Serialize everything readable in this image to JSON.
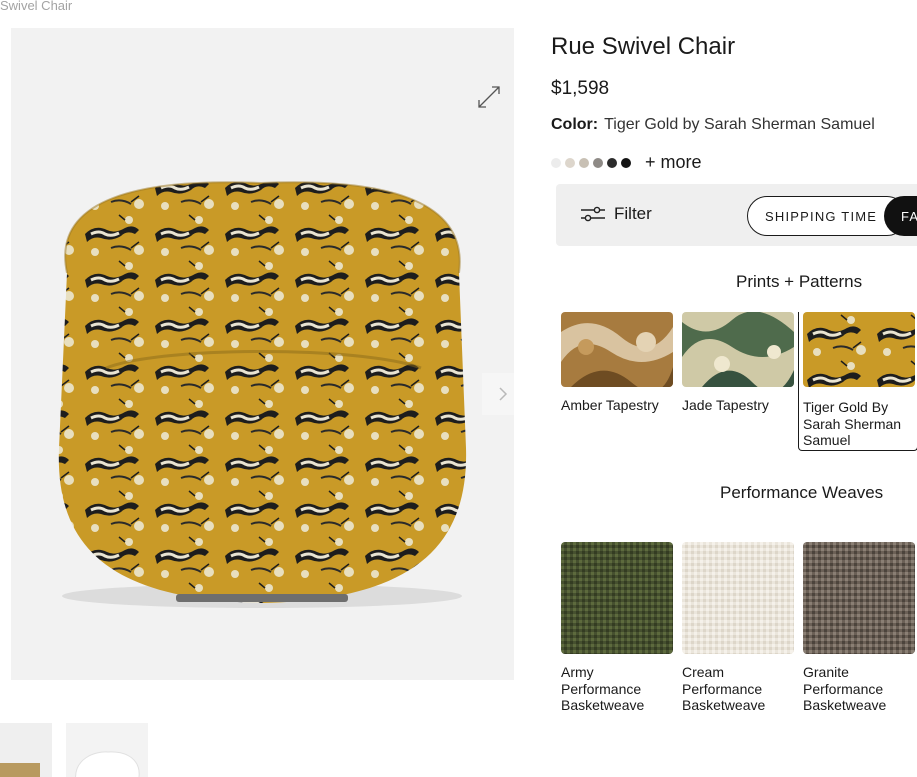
{
  "breadcrumb": {
    "current": "Swivel Chair"
  },
  "product": {
    "title": "Rue Swivel Chair",
    "price": "$1,598",
    "color_label": "Color:",
    "color_value": "Tiger Gold by Sarah Sherman Samuel",
    "more_label": "+ more",
    "swatch_dots": [
      "#ececec",
      "#ddd6cc",
      "#c8c0b4",
      "#8e8a86",
      "#2b2b2b",
      "#141414"
    ]
  },
  "filter": {
    "label": "Filter",
    "pills": [
      "SHIPPING TIME",
      "FA"
    ]
  },
  "sections": [
    {
      "heading": "Prints + Patterns",
      "fabrics": [
        {
          "name": "Amber Tapestry"
        },
        {
          "name": "Jade Tapestry"
        },
        {
          "name": "Tiger Gold By Sarah Sherman Samuel",
          "selected": true
        }
      ]
    },
    {
      "heading": "Performance Weaves",
      "fabrics": [
        {
          "name": "Army Performance Basketweave"
        },
        {
          "name": "Cream Performance Basketweave"
        },
        {
          "name": "Granite Performance Basketweave"
        }
      ]
    }
  ],
  "colors": {
    "accent": "#1a1a1a",
    "chair_fabric": "#c99a27",
    "panel_bg": "#efefef"
  },
  "icons": [
    "expand-icon",
    "chevron-right-icon",
    "filter-sliders-icon"
  ]
}
